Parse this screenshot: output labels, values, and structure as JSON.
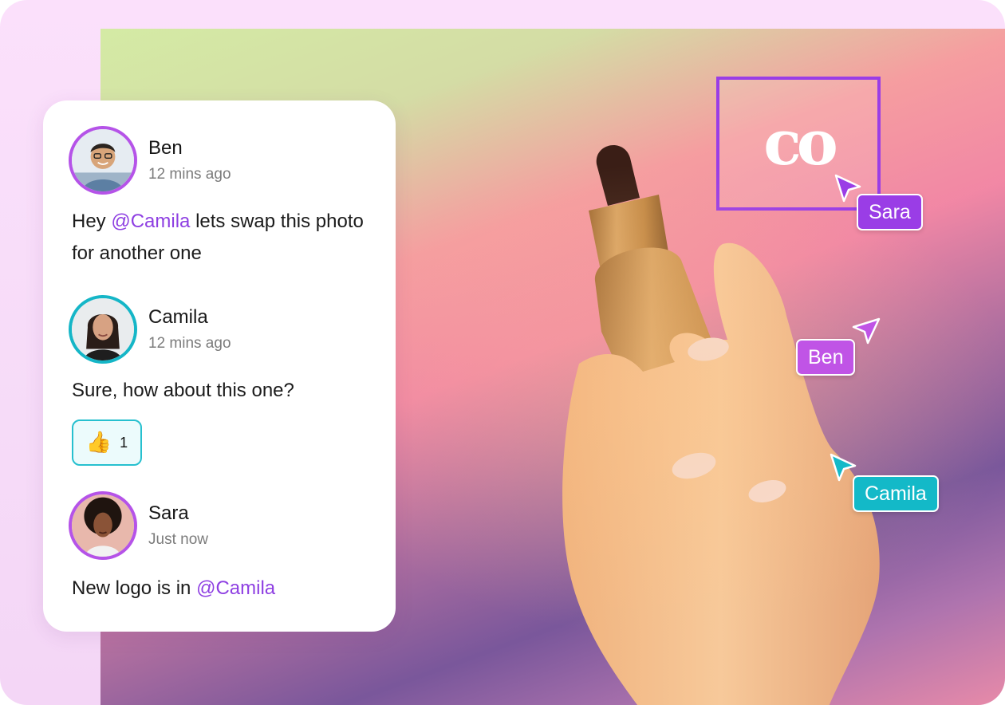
{
  "comments": [
    {
      "author": "Ben",
      "time": "12 mins ago",
      "text_before": "Hey ",
      "mention": "@Camila",
      "text_after": " lets swap this photo for another one"
    },
    {
      "author": "Camila",
      "time": "12 mins ago",
      "text": "Sure, how about this one?",
      "reaction": {
        "emoji": "👍",
        "count": "1"
      }
    },
    {
      "author": "Sara",
      "time": "Just now",
      "text_before": "New logo is in ",
      "mention": "@Camila"
    }
  ],
  "canvas": {
    "logo": "co",
    "cursors": [
      {
        "name": "Sara",
        "color": "#9a3de6"
      },
      {
        "name": "Ben",
        "color": "#c054e6"
      },
      {
        "name": "Camila",
        "color": "#13b9c8"
      }
    ]
  },
  "colors": {
    "mention": "#8e3fe2",
    "avatar_purple": "#b553e8",
    "avatar_teal": "#15b6c7",
    "selection": "#9a3de6"
  }
}
